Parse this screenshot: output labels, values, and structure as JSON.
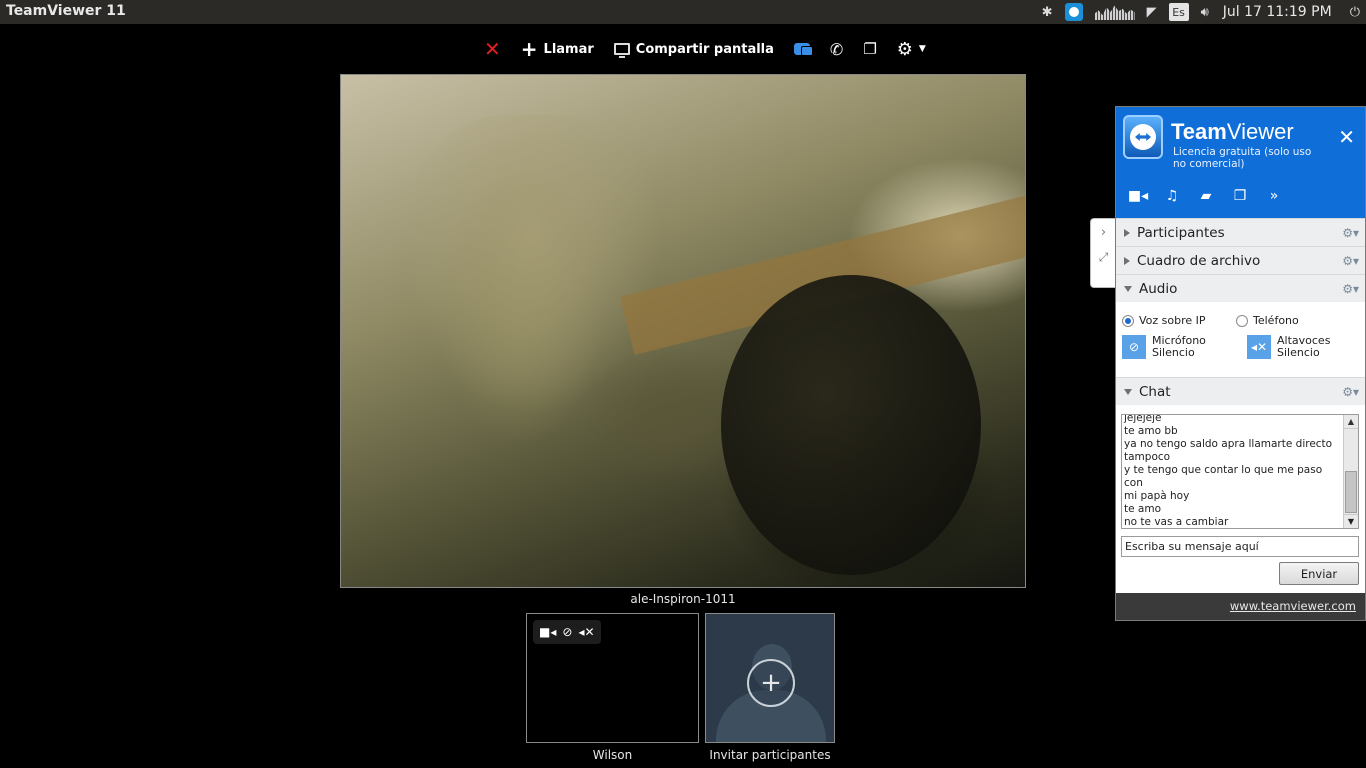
{
  "topbar": {
    "app_title": "TeamViewer 11",
    "keyboard_layout": "Es",
    "clock": "Jul 17 11:19 PM"
  },
  "toolbar": {
    "close_label": "✕",
    "call_label": "Llamar",
    "share_label": "Compartir pantalla",
    "icons": [
      "close-icon",
      "plus-icon",
      "screen-share-icon",
      "chat-icon",
      "phone-icon",
      "files-icon",
      "gear-icon"
    ]
  },
  "video": {
    "caption": "ale-Inspiron-1011"
  },
  "thumbnails": {
    "self_name": "Wilson",
    "invite_label": "Invitar participantes"
  },
  "panel": {
    "brand_bold": "Team",
    "brand_light": "Viewer",
    "license": "Licencia gratuita (solo uso no comercial)",
    "sections": {
      "participants": "Participantes",
      "files": "Cuadro de archivo",
      "audio": "Audio",
      "chat": "Chat"
    },
    "audio": {
      "voip_label": "Voz sobre IP",
      "phone_label": "Teléfono",
      "mic_label": "Micrófono",
      "mic_state": "Silencio",
      "speaker_label": "Altavoces",
      "speaker_state": "Silencio"
    },
    "chat": {
      "messages": [
        "jejejeje",
        "te amo bb",
        "ya no tengo saldo apra llamarte directo",
        "tampoco",
        "y te tengo que contar lo que me paso con",
        "mi papà hoy",
        "te amo",
        "no te vas a cambiar",
        "???"
      ],
      "input_placeholder": "Escriba su mensaje aquí",
      "send_label": "Enviar"
    },
    "footer_link": "www.teamviewer.com"
  },
  "colors": {
    "panel_header": "#0f6ed8",
    "close_red": "#e02020",
    "accent_blue": "#3a8ee6"
  }
}
